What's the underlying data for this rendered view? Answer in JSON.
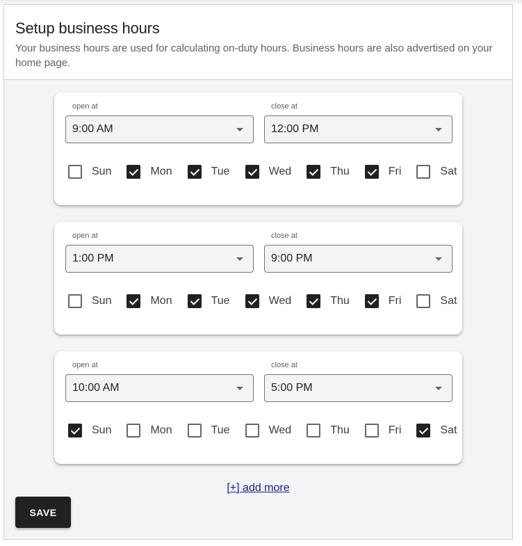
{
  "header": {
    "title": "Setup business hours",
    "description": "Your business hours are used for calculating on-duty hours. Business hours are also advertised on your home page."
  },
  "labels": {
    "open_at": "open at",
    "close_at": "close at"
  },
  "day_names": [
    "Sun",
    "Mon",
    "Tue",
    "Wed",
    "Thu",
    "Fri",
    "Sat"
  ],
  "schedules": [
    {
      "open": "9:00 AM",
      "close": "12:00 PM",
      "days": [
        false,
        true,
        true,
        true,
        true,
        true,
        false
      ]
    },
    {
      "open": "1:00 PM",
      "close": "9:00 PM",
      "days": [
        false,
        true,
        true,
        true,
        true,
        true,
        false
      ]
    },
    {
      "open": "10:00 AM",
      "close": "5:00 PM",
      "days": [
        true,
        false,
        false,
        false,
        false,
        false,
        true
      ]
    }
  ],
  "actions": {
    "add_more": "[+] add more",
    "save": "SAVE"
  },
  "colors": {
    "checked": "#202124",
    "link": "#1a1a8c",
    "button": "#212121",
    "panel_bg": "#f3f4f6"
  }
}
